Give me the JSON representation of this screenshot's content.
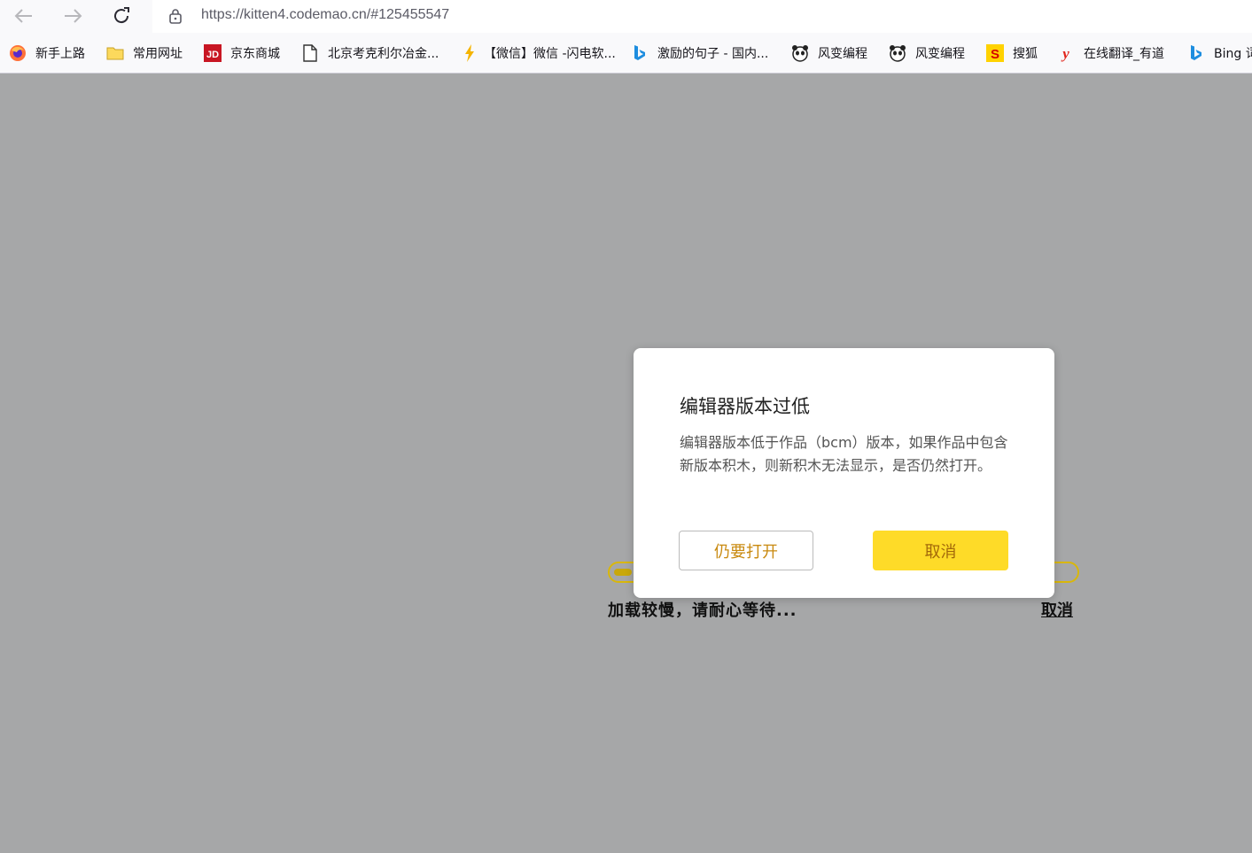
{
  "browser": {
    "url_host": "https://kitten4.codemao.cn/",
    "url_hash": "#125455547",
    "bookmarks": [
      {
        "label": "新手上路",
        "icon": "firefox-icon"
      },
      {
        "label": "常用网址",
        "icon": "folder-icon"
      },
      {
        "label": "京东商城",
        "icon": "jd-icon"
      },
      {
        "label": "北京考克利尔冶金...",
        "icon": "page-icon"
      },
      {
        "label": "【微信】微信 -闪电软...",
        "icon": "lightning-icon"
      },
      {
        "label": "激励的句子 - 国内...",
        "icon": "bing-icon"
      },
      {
        "label": "风变编程",
        "icon": "panda-icon"
      },
      {
        "label": "风变编程",
        "icon": "panda-icon"
      },
      {
        "label": "搜狐",
        "icon": "sohu-icon"
      },
      {
        "label": "在线翻译_有道",
        "icon": "youdao-icon"
      },
      {
        "label": "Bing 词",
        "icon": "bing-icon"
      }
    ]
  },
  "loader": {
    "text": "加载较慢，请耐心等待...",
    "cancel_label": "取消",
    "progress": 0.04
  },
  "dialog": {
    "title": "编辑器版本过低",
    "message": "编辑器版本低于作品（bcm）版本，如果作品中包含新版本积木，则新积木无法显示，是否仍然打开。",
    "open_label": "仍要打开",
    "cancel_label": "取消"
  },
  "colors": {
    "accent_yellow": "#fedb28",
    "accent_text": "#c98a10",
    "overlay": "#a6a7a8"
  }
}
